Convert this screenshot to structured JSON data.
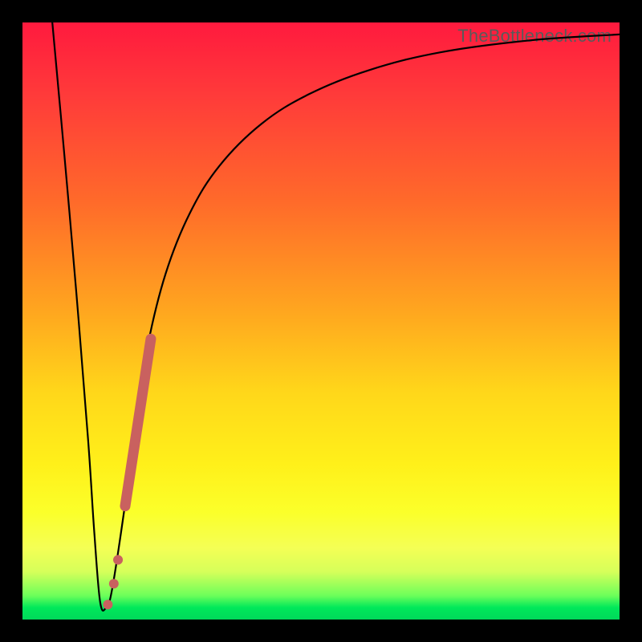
{
  "watermark": "TheBottleneck.com",
  "colors": {
    "curve": "#000000",
    "marker": "#c9615f",
    "background_black": "#000000"
  },
  "chart_data": {
    "type": "line",
    "title": "",
    "xlabel": "",
    "ylabel": "",
    "xlim": [
      0,
      100
    ],
    "ylim": [
      0,
      100
    ],
    "grid": false,
    "legend": false,
    "series": [
      {
        "name": "bottleneck-curve",
        "x": [
          5,
          7,
          9,
          11,
          12,
          13,
          14,
          15,
          17,
          19,
          21,
          24,
          28,
          33,
          40,
          48,
          58,
          70,
          85,
          100
        ],
        "y": [
          100,
          78,
          55,
          30,
          15,
          3,
          2,
          5,
          18,
          33,
          46,
          58,
          68,
          76,
          83,
          88,
          92,
          95,
          97,
          98
        ]
      }
    ],
    "markers": [
      {
        "name": "thick-red-segment",
        "shape": "thick-line",
        "x": [
          17.2,
          21.5
        ],
        "y": [
          19,
          47
        ]
      },
      {
        "name": "small-dot-1",
        "shape": "dot",
        "x": 15.3,
        "y": 6
      },
      {
        "name": "small-dot-2",
        "shape": "dot",
        "x": 16.0,
        "y": 10
      },
      {
        "name": "small-dot-3",
        "shape": "dot",
        "x": 14.3,
        "y": 2.5
      }
    ]
  }
}
